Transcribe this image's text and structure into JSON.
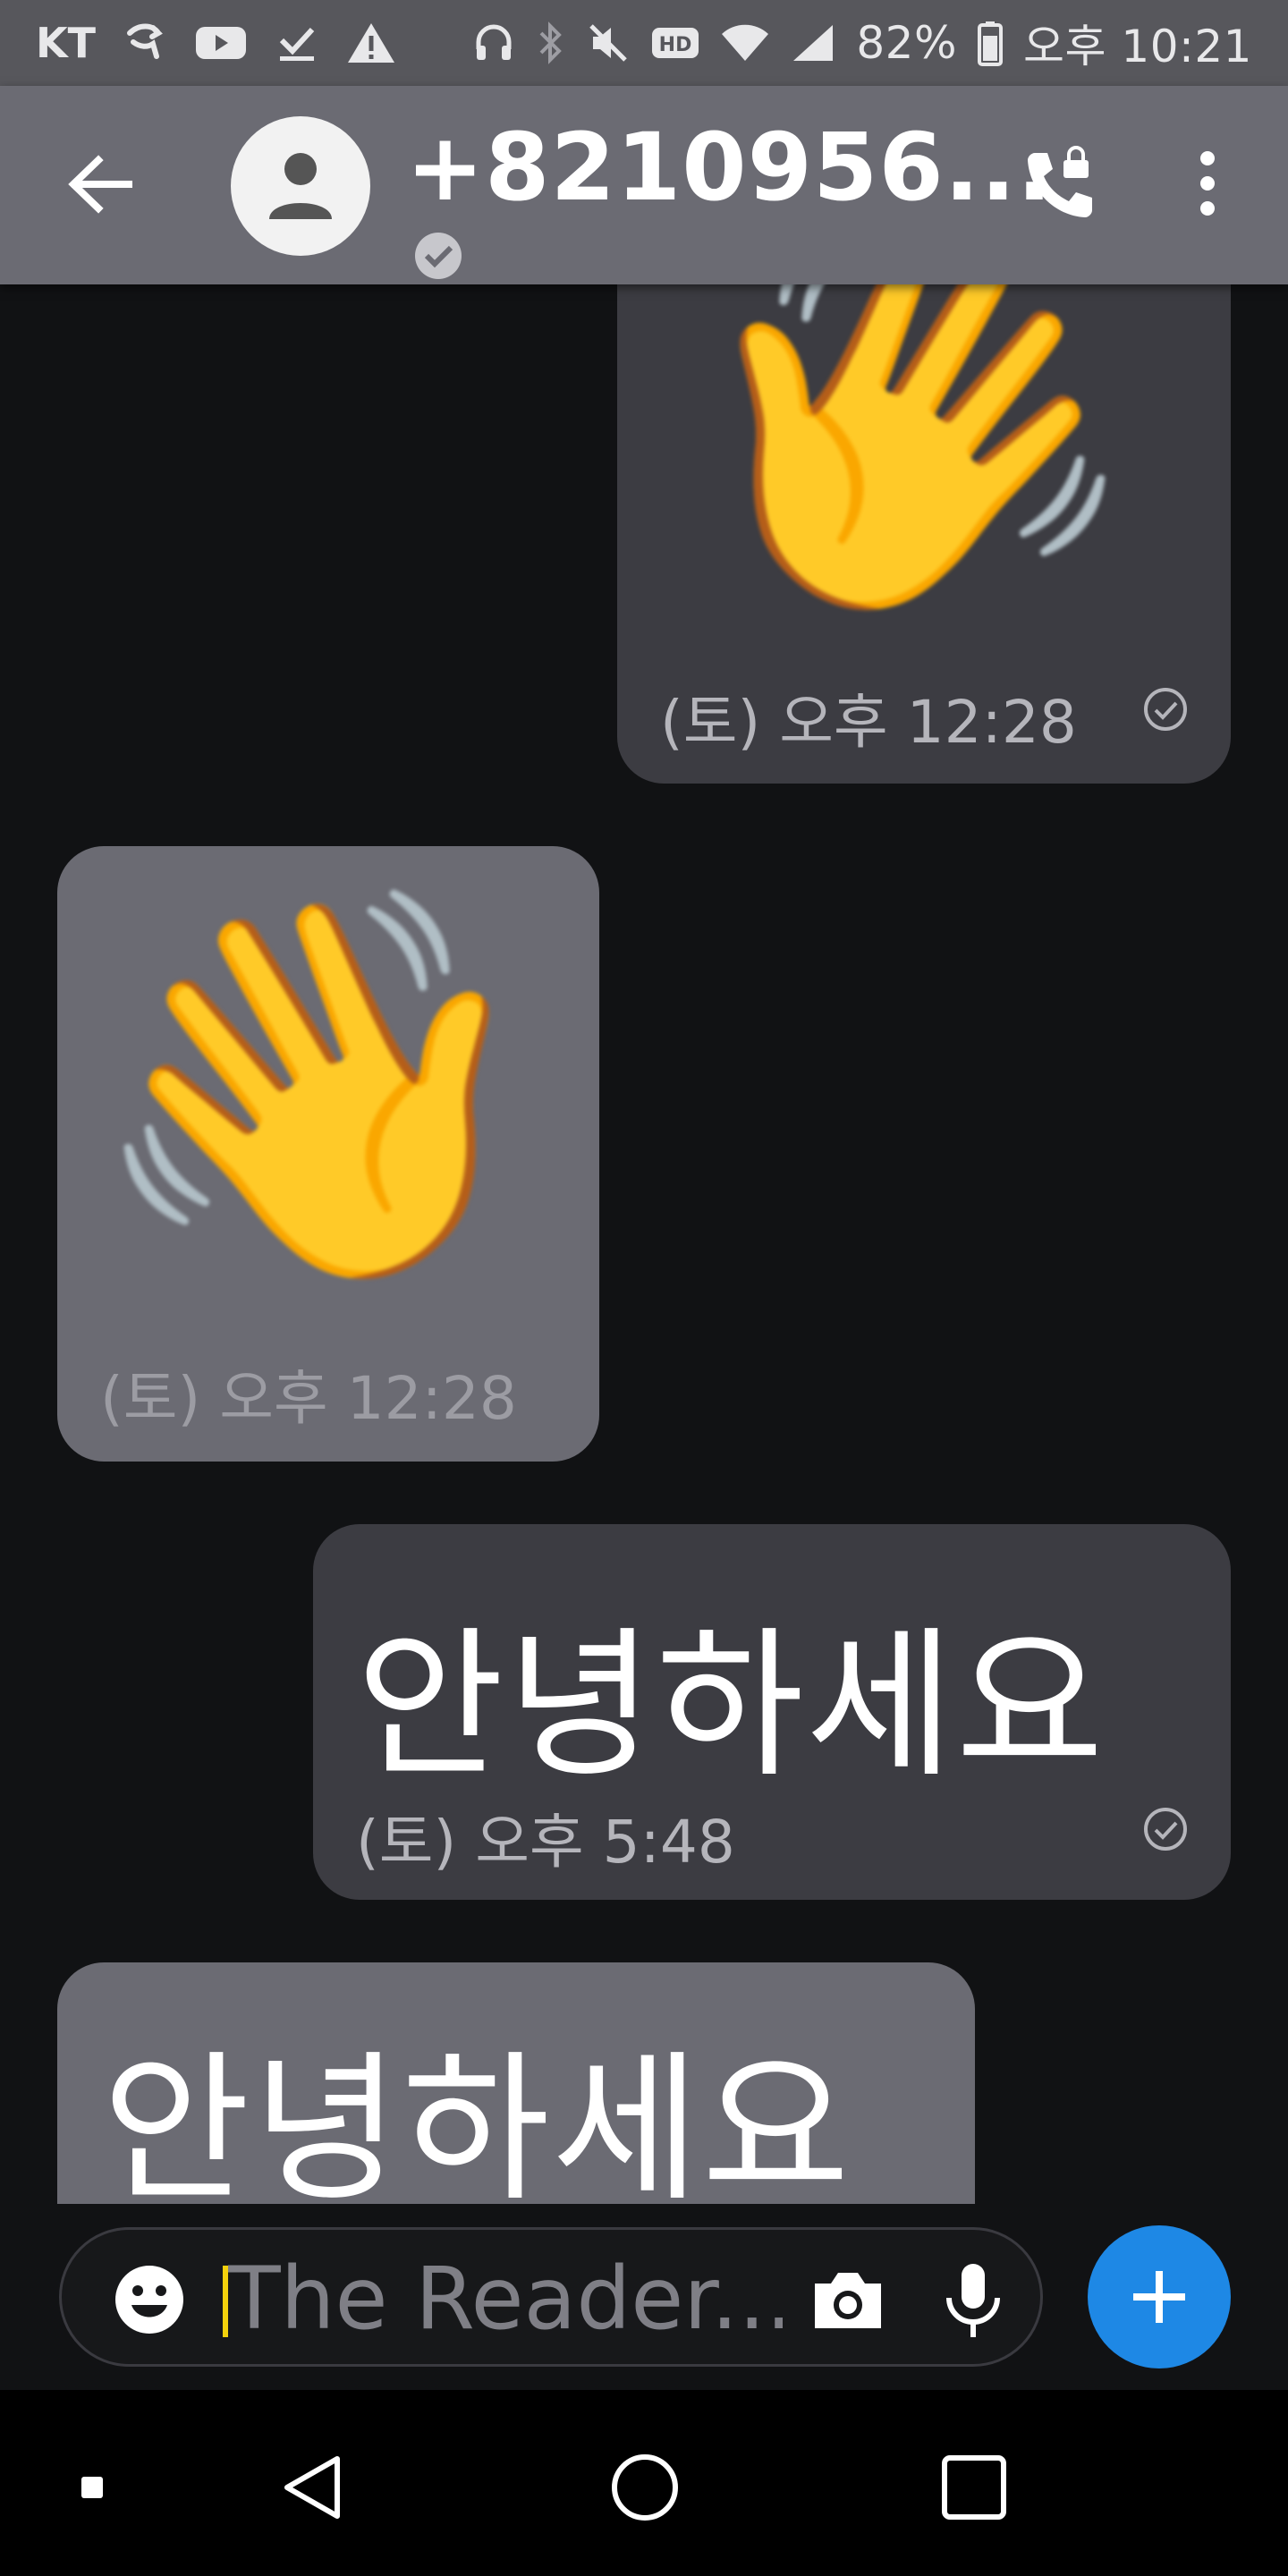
{
  "status_bar": {
    "carrier": "KT",
    "battery": "82%",
    "time": "오후 10:21",
    "icons": [
      "call-forward-icon",
      "youtube-icon",
      "check-icon",
      "warning-icon",
      "headset-icon",
      "bluetooth-icon",
      "mute-icon",
      "hd-icon",
      "wifi-icon",
      "signal-icon",
      "battery-icon"
    ]
  },
  "header": {
    "contact_name": "+8210956...",
    "icons": [
      "back-arrow-icon",
      "person-icon",
      "verified-check-icon",
      "secure-call-icon",
      "more-vert-icon"
    ]
  },
  "messages": [
    {
      "direction": "outgoing",
      "content": "👋",
      "timestamp": "(토) 오후 12:28",
      "read": true
    },
    {
      "direction": "incoming",
      "content": "👋",
      "timestamp": "(토) 오후 12:28"
    },
    {
      "direction": "outgoing",
      "content": "안녕하세요",
      "timestamp": "(토) 오후 5:48",
      "read": true
    },
    {
      "direction": "incoming",
      "content": "안녕하세요"
    }
  ],
  "composer": {
    "placeholder": "The Reader...",
    "icons": [
      "emoji-icon",
      "camera-icon",
      "mic-icon",
      "plus-icon"
    ]
  },
  "colors": {
    "header_bg": "#6b6b73",
    "outgoing_bubble": "#3c3c42",
    "incoming_bubble": "#6b6b73",
    "fab": "#1e88e5",
    "caret": "#f4d10c"
  }
}
